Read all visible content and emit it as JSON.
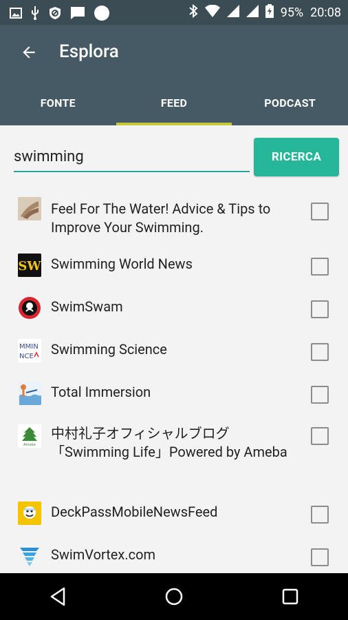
{
  "status_bar": {
    "battery": "95%",
    "time": "20:08"
  },
  "app_bar": {
    "title": "Esplora"
  },
  "tabs": [
    {
      "label": "FONTE",
      "active": false
    },
    {
      "label": "FEED",
      "active": true
    },
    {
      "label": "PODCAST",
      "active": false
    }
  ],
  "search": {
    "value": "swimming",
    "button_label": "RICERCA"
  },
  "feeds": [
    {
      "title": "Feel For The Water! Advice & Tips to Improve Your Swimming.",
      "icon": "hand-photo-icon",
      "checked": false
    },
    {
      "title": "Swimming World News",
      "icon": "sw-logo-icon",
      "checked": false
    },
    {
      "title": "SwimSwam",
      "icon": "swimswam-logo-icon",
      "checked": false
    },
    {
      "title": "Swimming Science",
      "icon": "swimming-science-logo-icon",
      "checked": false
    },
    {
      "title": "Total Immersion",
      "icon": "total-immersion-logo-icon",
      "checked": false
    },
    {
      "title": "中村礼子オフィシャルブログ「Swimming Life」Powered by Ameba",
      "icon": "ameba-logo-icon",
      "checked": false
    },
    {
      "title": "DeckPassMobileNewsFeed",
      "icon": "deckpass-logo-icon",
      "checked": false
    },
    {
      "title": "SwimVortex.com",
      "icon": "swimvortex-logo-icon",
      "checked": false
    }
  ],
  "colors": {
    "status_bar": "#3b4c55",
    "app_bar": "#455a64",
    "tab_indicator": "#c7c837",
    "accent": "#26b79b"
  }
}
